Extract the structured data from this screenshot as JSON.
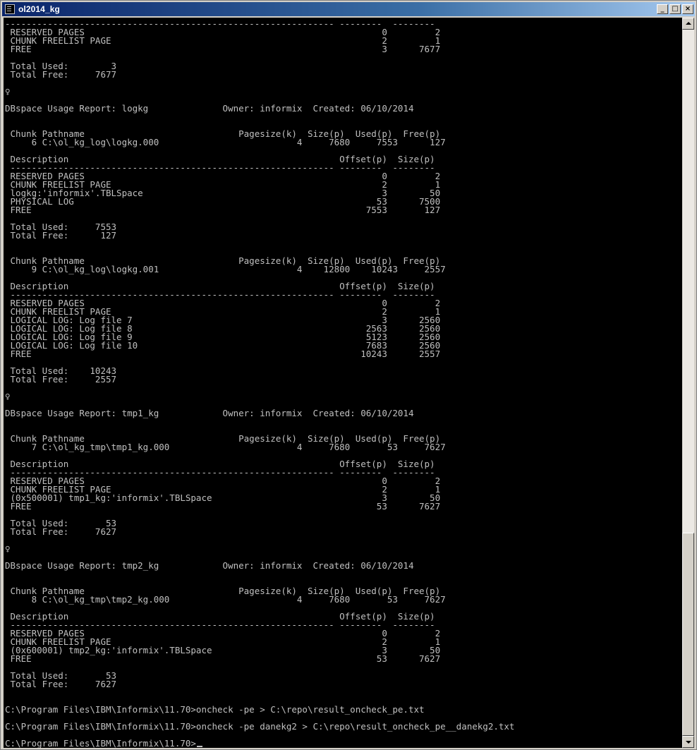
{
  "window": {
    "title": "ol2014_kg",
    "buttons": {
      "minimize": "_",
      "maximize": "□",
      "close": "×"
    },
    "icon": "console-window-icon"
  },
  "console": {
    "lines": [
      "-------------------------------------------------------------- --------  --------",
      " RESERVED PAGES                                                        0         2",
      " CHUNK FREELIST PAGE                                                   2         1",
      " FREE                                                                  3      7677",
      "",
      " Total Used:        3",
      " Total Free:     7677",
      "",
      "♀",
      "",
      "DBspace Usage Report: logkg              Owner: informix  Created: 06/10/2014",
      "",
      "",
      " Chunk Pathname                             Pagesize(k)  Size(p)  Used(p)  Free(p)",
      "     6 C:\\ol_kg_log\\logkg.000                          4     7680     7553      127",
      "",
      " Description                                                   Offset(p)  Size(p)",
      " ------------------------------------------------------------- --------  --------",
      " RESERVED PAGES                                                        0         2",
      " CHUNK FREELIST PAGE                                                   2         1",
      " logkg:'informix'.TBLSpace                                             3        50",
      " PHYSICAL LOG                                                         53      7500",
      " FREE                                                               7553       127",
      "",
      " Total Used:     7553",
      " Total Free:      127",
      "",
      "",
      " Chunk Pathname                             Pagesize(k)  Size(p)  Used(p)  Free(p)",
      "     9 C:\\ol_kg_log\\logkg.001                          4    12800    10243     2557",
      "",
      " Description                                                   Offset(p)  Size(p)",
      " ------------------------------------------------------------- --------  --------",
      " RESERVED PAGES                                                        0         2",
      " CHUNK FREELIST PAGE                                                   2         1",
      " LOGICAL LOG: Log file 7                                               3      2560",
      " LOGICAL LOG: Log file 8                                            2563      2560",
      " LOGICAL LOG: Log file 9                                            5123      2560",
      " LOGICAL LOG: Log file 10                                           7683      2560",
      " FREE                                                              10243      2557",
      "",
      " Total Used:    10243",
      " Total Free:     2557",
      "",
      "♀",
      "",
      "DBspace Usage Report: tmp1_kg            Owner: informix  Created: 06/10/2014",
      "",
      "",
      " Chunk Pathname                             Pagesize(k)  Size(p)  Used(p)  Free(p)",
      "     7 C:\\ol_kg_tmp\\tmp1_kg.000                        4     7680       53     7627",
      "",
      " Description                                                   Offset(p)  Size(p)",
      " ------------------------------------------------------------- --------  --------",
      " RESERVED PAGES                                                        0         2",
      " CHUNK FREELIST PAGE                                                   2         1",
      " (0x500001) tmp1_kg:'informix'.TBLSpace                                3        50",
      " FREE                                                                 53      7627",
      "",
      " Total Used:       53",
      " Total Free:     7627",
      "",
      "♀",
      "",
      "DBspace Usage Report: tmp2_kg            Owner: informix  Created: 06/10/2014",
      "",
      "",
      " Chunk Pathname                             Pagesize(k)  Size(p)  Used(p)  Free(p)",
      "     8 C:\\ol_kg_tmp\\tmp2_kg.000                        4     7680       53     7627",
      "",
      " Description                                                   Offset(p)  Size(p)",
      " ------------------------------------------------------------- --------  --------",
      " RESERVED PAGES                                                        0         2",
      " CHUNK FREELIST PAGE                                                   2         1",
      " (0x600001) tmp2_kg:'informix'.TBLSpace                                3        50",
      " FREE                                                                 53      7627",
      "",
      " Total Used:       53",
      " Total Free:     7627",
      "",
      "",
      "C:\\Program Files\\IBM\\Informix\\11.70>oncheck -pe > C:\\repo\\result_oncheck_pe.txt",
      "",
      "C:\\Program Files\\IBM\\Informix\\11.70>oncheck -pe danekg2 > C:\\repo\\result_oncheck_pe__danekg2.txt",
      ""
    ],
    "prompt": "C:\\Program Files\\IBM\\Informix\\11.70>"
  }
}
